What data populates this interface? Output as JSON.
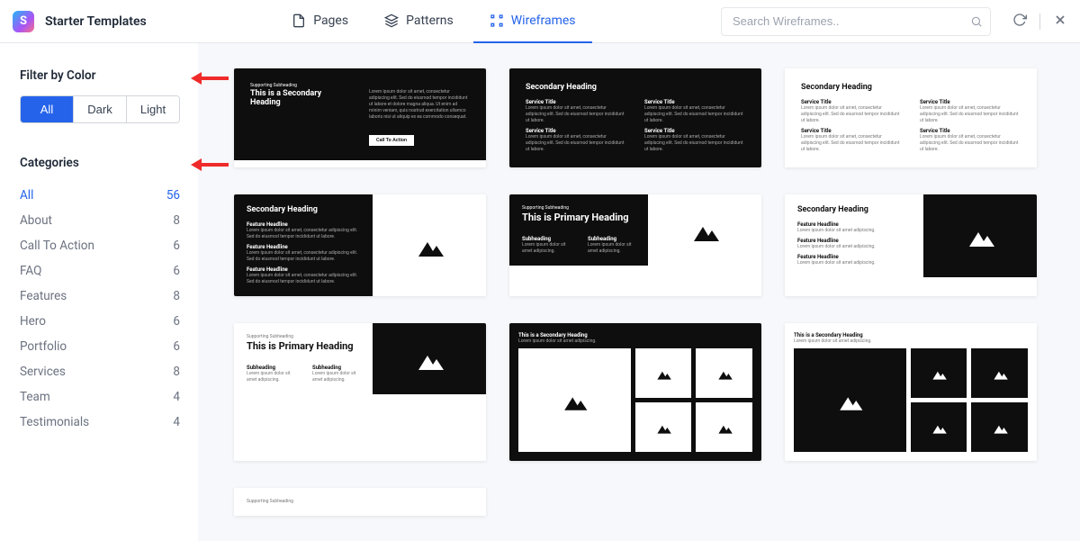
{
  "app_title": "Starter Templates",
  "tabs": {
    "pages": "Pages",
    "patterns": "Patterns",
    "wireframes": "Wireframes"
  },
  "search": {
    "placeholder": "Search Wireframes.."
  },
  "sidebar": {
    "filter_title": "Filter by Color",
    "colors": {
      "all": "All",
      "dark": "Dark",
      "light": "Light"
    },
    "categories_title": "Categories",
    "items": [
      {
        "label": "All",
        "count": "56"
      },
      {
        "label": "About",
        "count": "8"
      },
      {
        "label": "Call To Action",
        "count": "6"
      },
      {
        "label": "FAQ",
        "count": "6"
      },
      {
        "label": "Features",
        "count": "8"
      },
      {
        "label": "Hero",
        "count": "6"
      },
      {
        "label": "Portfolio",
        "count": "6"
      },
      {
        "label": "Services",
        "count": "8"
      },
      {
        "label": "Team",
        "count": "4"
      },
      {
        "label": "Testimonials",
        "count": "4"
      }
    ]
  },
  "wf": {
    "supporting": "Supporting Subheading",
    "secondary_small": "This is a Secondary Heading",
    "secondary": "Secondary Heading",
    "primary": "This is Primary Heading",
    "sub": "Subheading",
    "service": "Service Title",
    "feature": "Feature Headline",
    "cta": "Call To Action",
    "lorem_long": "Lorem ipsum dolor sit amet, consectetur adipiscing elit. Sed do eiusmod tempor incididunt ut labore et dolore magna aliqua. Ut enim ad minim veniam, quis nostrud exercitation ullamco laboris nisi ut aliquip ex ea commodo consequat.",
    "lorem_med": "Lorem ipsum dolor sit amet, consectetur adipiscing elit. Sed do eiusmod tempor incididunt ut labore.",
    "lorem_short": "Lorem ipsum dolor sit amet adipiscing."
  }
}
